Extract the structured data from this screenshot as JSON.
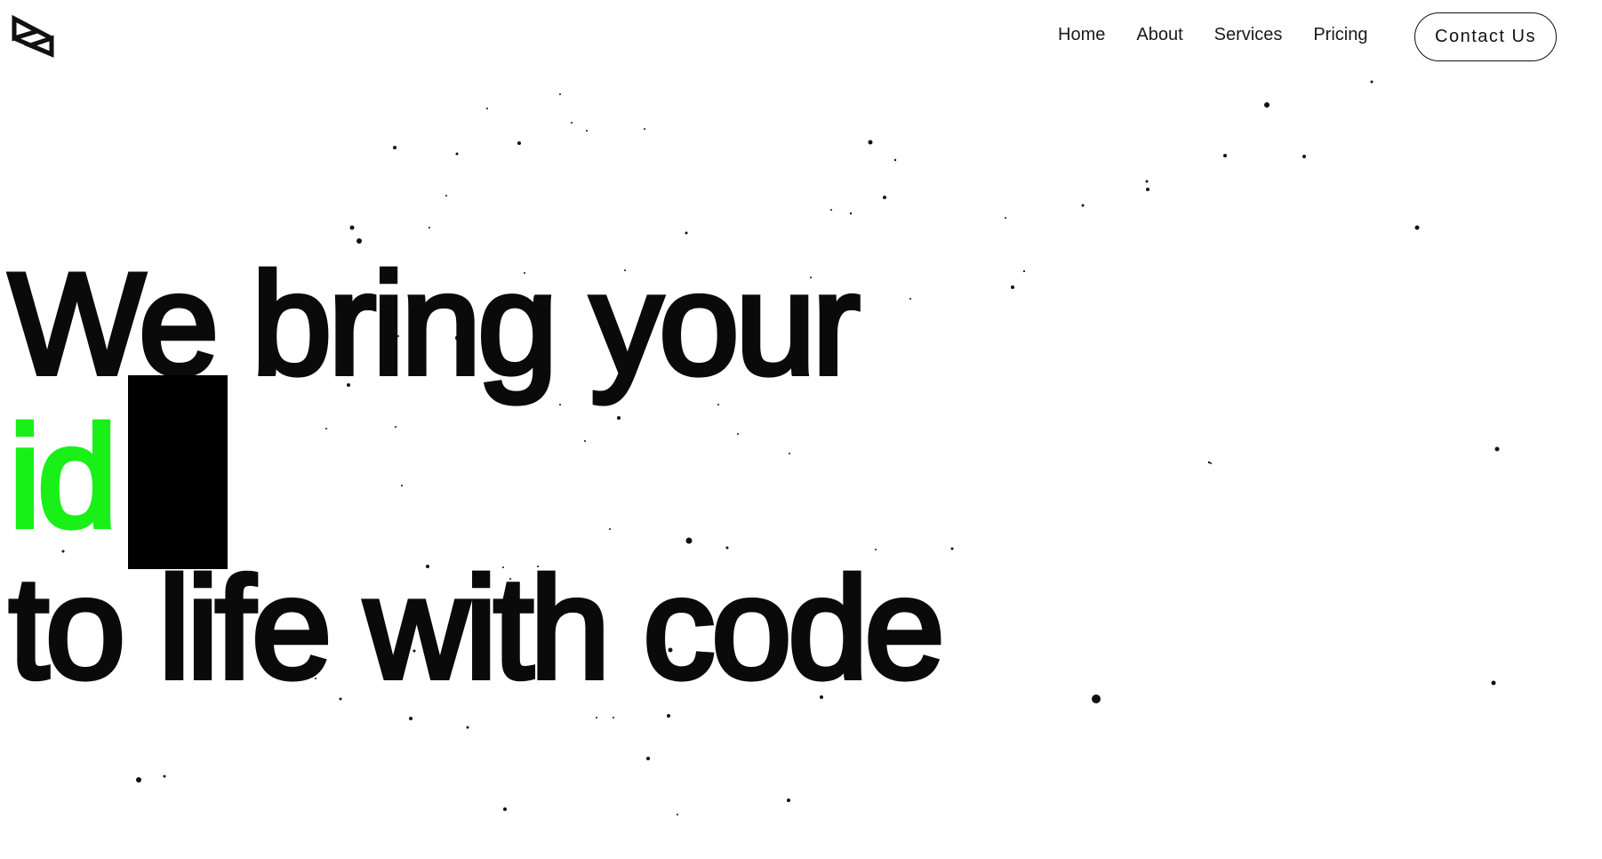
{
  "header": {
    "logo_icon": "play-bowtie-logo-icon",
    "nav": [
      {
        "label": "Home"
      },
      {
        "label": "About"
      },
      {
        "label": "Services"
      },
      {
        "label": "Pricing"
      }
    ],
    "contact_label": "Contact Us"
  },
  "hero": {
    "line1": "We bring your",
    "line2_typed": "id",
    "line3": "to life with code"
  },
  "colors": {
    "background": "#ffffff",
    "text": "#0a0a0a",
    "accent_green": "#18f018",
    "cursor": "#000000"
  }
}
